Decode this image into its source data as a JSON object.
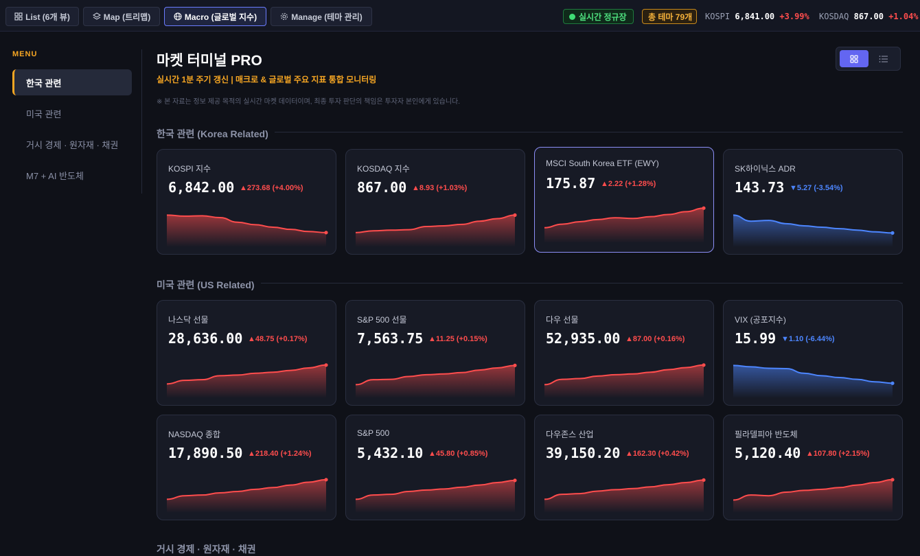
{
  "topbar": {
    "tabs": [
      {
        "label": "List (6개 뷰)",
        "icon": "grid-icon",
        "active": false
      },
      {
        "label": "Map (트리맵)",
        "icon": "layers-icon",
        "active": false
      },
      {
        "label": "Macro (글로벌 지수)",
        "icon": "globe-icon",
        "active": true
      },
      {
        "label": "Manage (테마 관리)",
        "icon": "gear-icon",
        "active": false
      }
    ],
    "live_badge": "실시간 정규장",
    "theme_badge": "총 테마 79개",
    "tickers": [
      {
        "name": "KOSPI",
        "value": "6,841.00",
        "change": "+3.99%"
      },
      {
        "name": "KOSDAQ",
        "value": "867.00",
        "change": "+1.04%"
      }
    ]
  },
  "sidebar": {
    "title": "MENU",
    "items": [
      {
        "label": "한국 관련",
        "active": true
      },
      {
        "label": "미국 관련",
        "active": false
      },
      {
        "label": "거시 경제 · 원자재 · 채권",
        "active": false
      },
      {
        "label": "M7 + AI 반도체",
        "active": false
      }
    ]
  },
  "header": {
    "title": "마켓 터미널 PRO",
    "subtitle": "실시간 1분 주기 갱신 | 매크로 & 글로벌 주요 지표 통합 모니터링",
    "disclaimer": "※ 본 자료는 정보 제공 목적의 실시간 마켓 데이터이며, 최종 투자 판단의 책임은 투자자 본인에게 있습니다."
  },
  "colors": {
    "up": "#ff4d4d",
    "down": "#4d86ff",
    "accent": "#f6a623",
    "selected": "#8c8ff7"
  },
  "sections": [
    {
      "title": "한국 관련 (Korea Related)",
      "cards": [
        {
          "name": "KOSPI 지수",
          "price": "6,842.00",
          "change": "▲273.68 (+4.00%)",
          "dir": "up",
          "spark": [
            82,
            79,
            80,
            75,
            62,
            55,
            48,
            42,
            36,
            33
          ]
        },
        {
          "name": "KOSDAQ 지수",
          "price": "867.00",
          "change": "▲8.93 (+1.03%)",
          "dir": "up",
          "spark": [
            33,
            38,
            40,
            41,
            50,
            52,
            56,
            65,
            72,
            82
          ]
        },
        {
          "name": "MSCI South Korea ETF (EWY)",
          "price": "175.87",
          "change": "▲2.22 (+1.28%)",
          "dir": "up",
          "spark": [
            35,
            45,
            52,
            58,
            63,
            61,
            66,
            72,
            80,
            90
          ]
        },
        {
          "name": "SK하이닉스 ADR",
          "price": "143.73",
          "change": "▼5.27 (-3.54%)",
          "dir": "down",
          "spark": [
            82,
            65,
            67,
            58,
            52,
            48,
            44,
            40,
            35,
            32
          ]
        }
      ]
    },
    {
      "title": "미국 관련 (US Related)",
      "cards": [
        {
          "name": "나스닥 선물",
          "price": "28,636.00",
          "change": "▲48.75 (+0.17%)",
          "dir": "up",
          "spark": [
            32,
            42,
            44,
            55,
            57,
            62,
            65,
            70,
            77,
            85
          ]
        },
        {
          "name": "S&P 500 선물",
          "price": "7,563.75",
          "change": "▲11.25 (+0.15%)",
          "dir": "up",
          "spark": [
            30,
            44,
            45,
            53,
            58,
            60,
            64,
            71,
            77,
            84
          ]
        },
        {
          "name": "다우 선물",
          "price": "52,935.00",
          "change": "▲87.00 (+0.16%)",
          "dir": "up",
          "spark": [
            30,
            45,
            47,
            54,
            58,
            60,
            65,
            72,
            78,
            85
          ]
        },
        {
          "name": "VIX (공포지수)",
          "price": "15.99",
          "change": "▼1.10 (-6.44%)",
          "dir": "down",
          "spark": [
            84,
            80,
            76,
            75,
            62,
            55,
            50,
            45,
            38,
            34
          ]
        }
      ]
    },
    {
      "title": "거시 경제 · 원자재 · 채권",
      "cards": [
        {
          "name": "NASDAQ 종합",
          "price": "17,890.50",
          "change": "▲218.40 (+1.24%)",
          "dir": "up",
          "spark": [
            30,
            40,
            42,
            48,
            52,
            58,
            63,
            70,
            78,
            85
          ]
        },
        {
          "name": "S&P 500",
          "price": "5,432.10",
          "change": "▲45.80 (+0.85%)",
          "dir": "up",
          "spark": [
            30,
            42,
            44,
            52,
            56,
            59,
            64,
            70,
            77,
            83
          ]
        },
        {
          "name": "다우존스 산업",
          "price": "39,150.20",
          "change": "▲162.30 (+0.42%)",
          "dir": "up",
          "spark": [
            30,
            44,
            46,
            53,
            57,
            60,
            65,
            71,
            77,
            84
          ]
        },
        {
          "name": "필라델피아 반도체",
          "price": "5,120.40",
          "change": "▲107.80 (+2.15%)",
          "dir": "up",
          "spark": [
            28,
            42,
            40,
            50,
            55,
            58,
            63,
            70,
            77,
            85
          ]
        }
      ]
    }
  ]
}
